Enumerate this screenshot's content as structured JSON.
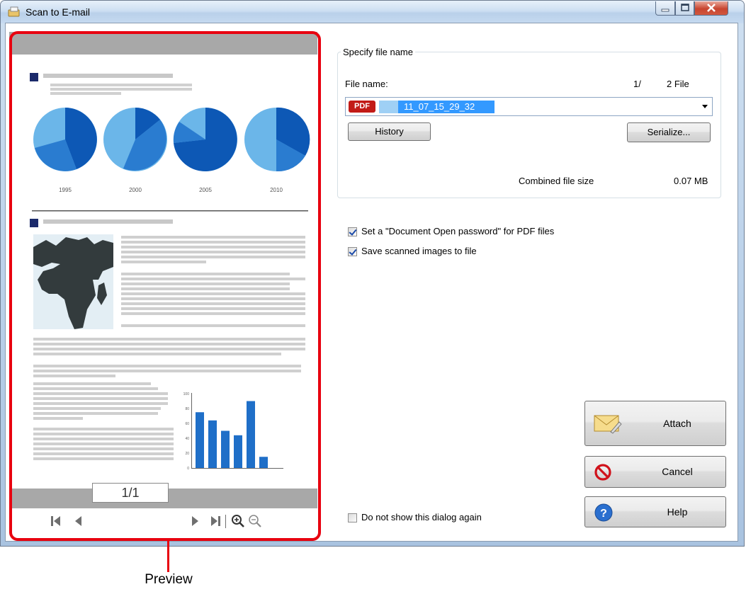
{
  "window": {
    "title": "Scan to E-mail"
  },
  "preview": {
    "page_indicator": "1/1",
    "chart_years": [
      "1995",
      "2000",
      "2005",
      "2010"
    ],
    "bar_axis_ticks": [
      "100",
      "80",
      "60",
      "40",
      "20",
      "0"
    ],
    "bar_values": [
      75,
      64,
      50,
      44,
      90,
      15
    ]
  },
  "callout": {
    "label": "Preview"
  },
  "file_group": {
    "legend": "Specify file name",
    "file_name_label": "File name:",
    "file_counter_current": "1/",
    "file_counter_total": "2 File",
    "file_type_badge": "PDF",
    "file_name_value": "11_07_15_29_32",
    "history_button": "History",
    "serialize_button": "Serialize...",
    "combined_size_label": "Combined file size",
    "combined_size_value": "0.07 MB"
  },
  "options": {
    "password_label": "Set a \"Document Open password\" for PDF files",
    "password_checked": true,
    "save_label": "Save scanned images to file",
    "save_checked": true,
    "dont_show_label": "Do not show this dialog again",
    "dont_show_checked": false
  },
  "actions": {
    "attach": "Attach",
    "cancel": "Cancel",
    "help": "Help"
  },
  "colors": {
    "accent_red": "#e8000f",
    "selection": "#3399ff",
    "pdf_badge": "#c21b17",
    "chart_blue": "#1f6fc8"
  }
}
